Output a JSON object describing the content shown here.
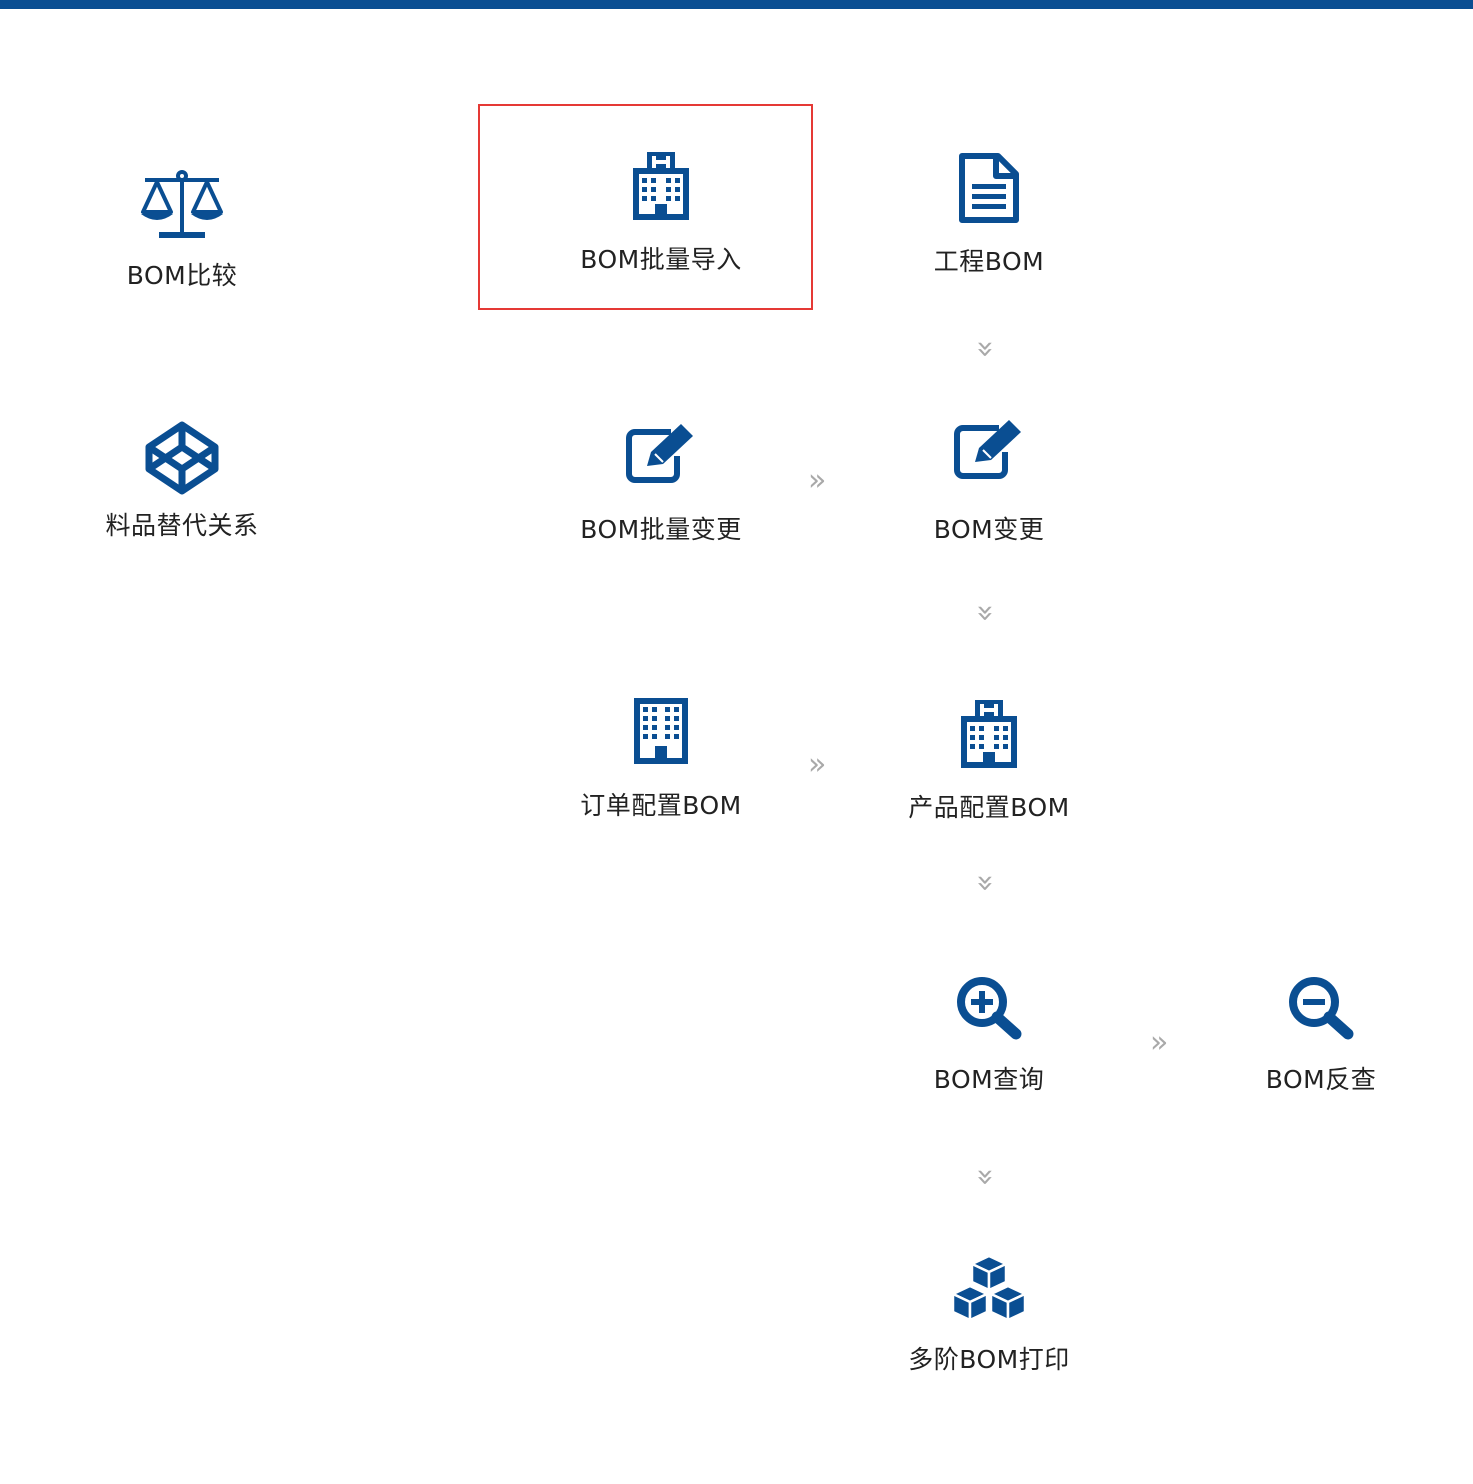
{
  "colors": {
    "icon_blue": "#0a4e92",
    "highlight_red": "#e53935",
    "arrow_gray": "#a9a9a9"
  },
  "arrow_glyph": "»",
  "nodes": {
    "bom_compare": {
      "label": "BOM比较",
      "icon": "scale-icon"
    },
    "material_substitute": {
      "label": "料品替代关系",
      "icon": "cube-icon"
    },
    "bom_batch_import": {
      "label": "BOM批量导入",
      "icon": "hospital-building-icon"
    },
    "engineering_bom": {
      "label": "工程BOM",
      "icon": "document-icon"
    },
    "bom_batch_change": {
      "label": "BOM批量变更",
      "icon": "edit-icon"
    },
    "bom_change": {
      "label": "BOM变更",
      "icon": "edit-icon"
    },
    "order_config_bom": {
      "label": "订单配置BOM",
      "icon": "building-icon"
    },
    "product_config_bom": {
      "label": "产品配置BOM",
      "icon": "hospital-building-icon"
    },
    "bom_query": {
      "label": "BOM查询",
      "icon": "zoom-in-icon"
    },
    "bom_reverse_query": {
      "label": "BOM反查",
      "icon": "zoom-out-icon"
    },
    "multilevel_bom_print": {
      "label": "多阶BOM打印",
      "icon": "cubes-icon"
    }
  }
}
